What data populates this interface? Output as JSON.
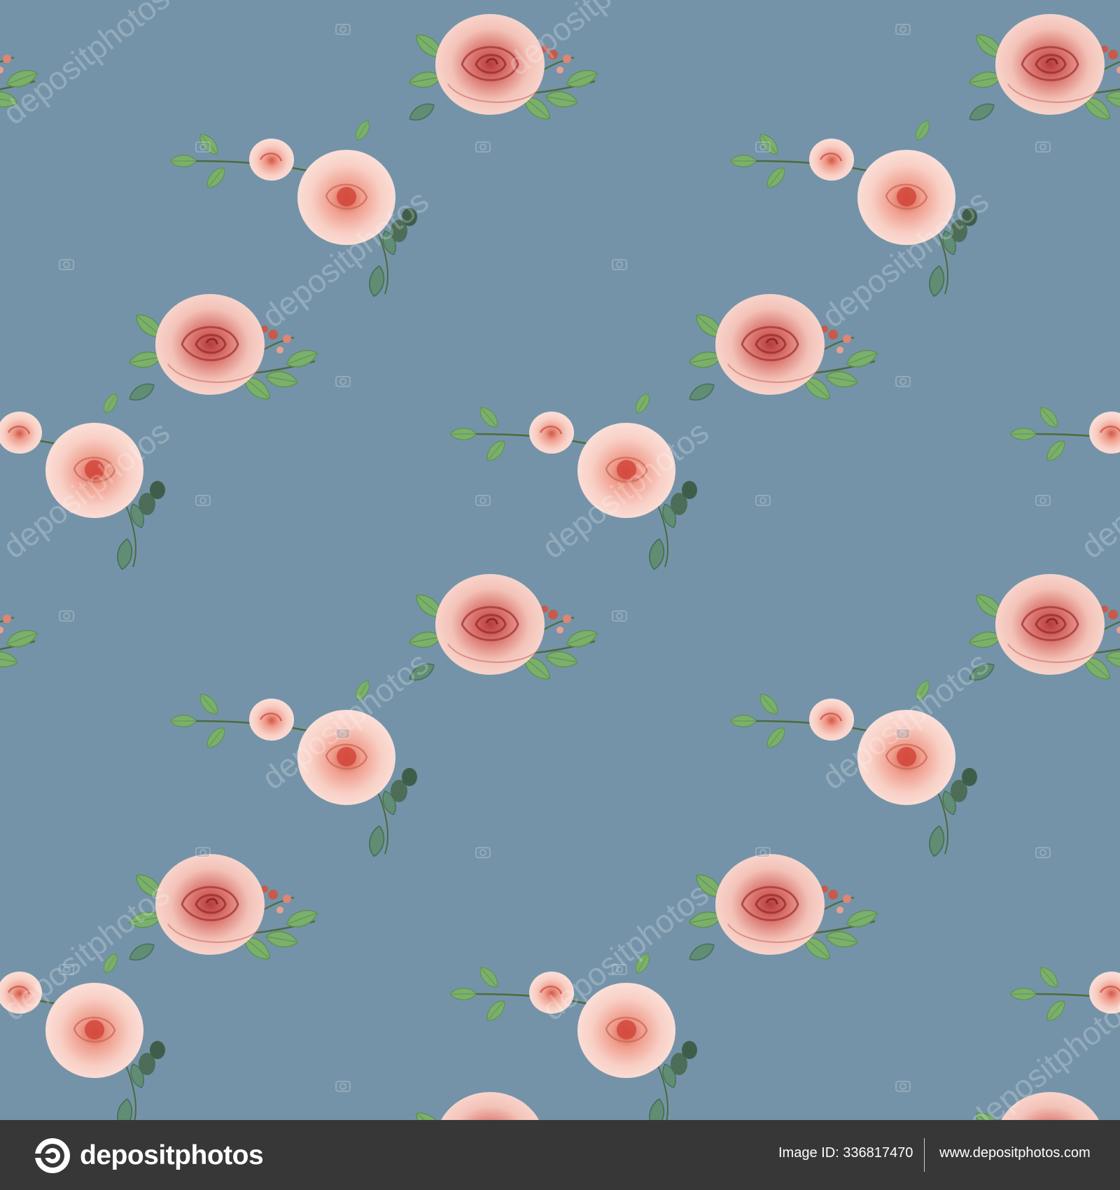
{
  "image": {
    "background_color": "#7593a8",
    "motif": "watercolor pink rose bouquets with green leaves, seamless pattern",
    "flower_colors": {
      "petal": "#f2c4ba",
      "center": "#c0504d",
      "leaf": "#7fb36a"
    }
  },
  "watermark": {
    "text": "depositphotos"
  },
  "footer": {
    "logo_text": "depositphotos",
    "logo_icon": "depositphotos-logo-icon",
    "image_id_text": "Image ID: 336817470",
    "website_text": "www.depositphotos.com"
  }
}
